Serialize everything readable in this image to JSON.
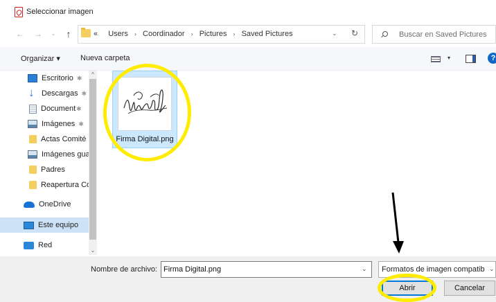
{
  "window": {
    "title": "Seleccionar imagen"
  },
  "nav": {
    "back": "←",
    "forward": "→",
    "recent": "⌄",
    "up": "↑",
    "breadcrumb_overflow": "«",
    "breadcrumbs": [
      "Users",
      "Coordinador",
      "Pictures",
      "Saved Pictures"
    ],
    "separator": "›",
    "address_dropdown": "⌄",
    "refresh": "↻",
    "search_placeholder": "Buscar en Saved Pictures"
  },
  "toolbar": {
    "organize": "Organizar ▾",
    "new_folder": "Nueva carpeta",
    "view_dropdown": "▾",
    "help": "?"
  },
  "sidebar": {
    "scroll_up": "^",
    "scroll_down": "⌄",
    "items": [
      {
        "label": "Escritorio",
        "icon": "desktop-icon",
        "pinned": true,
        "pin": "✱"
      },
      {
        "label": "Descargas",
        "icon": "download-icon",
        "pinned": true,
        "pin": "✱"
      },
      {
        "label": "Document",
        "icon": "document-icon",
        "pinned": true,
        "pin": "✱"
      },
      {
        "label": "Imágenes",
        "icon": "pictures-icon",
        "pinned": true,
        "pin": "✱"
      },
      {
        "label": "Actas Comité",
        "icon": "folder-icon",
        "pinned": false
      },
      {
        "label": "Imágenes gua",
        "icon": "pictures-icon",
        "pinned": false
      },
      {
        "label": "Padres",
        "icon": "folder-icon",
        "pinned": false
      },
      {
        "label": "Reapertura Co",
        "icon": "folder-icon",
        "pinned": false
      },
      {
        "label": "OneDrive",
        "icon": "cloud-icon",
        "pinned": false
      },
      {
        "label": "Este equipo",
        "icon": "computer-icon",
        "pinned": false,
        "selected": true
      },
      {
        "label": "Red",
        "icon": "network-icon",
        "pinned": false
      }
    ]
  },
  "content": {
    "files": [
      {
        "name": "Firma Digital.png",
        "selected": true,
        "thumbnail": "signature-image"
      }
    ]
  },
  "footer": {
    "filename_label": "Nombre de archivo:",
    "filename_value": "Firma Digital.png",
    "dropdown": "⌄",
    "filter": "Formatos de imagen compatib",
    "open_button": "Abrir",
    "cancel_button": "Cancelar"
  },
  "annotations": {
    "highlight_color": "#ffec00",
    "arrow_color": "#000000"
  }
}
